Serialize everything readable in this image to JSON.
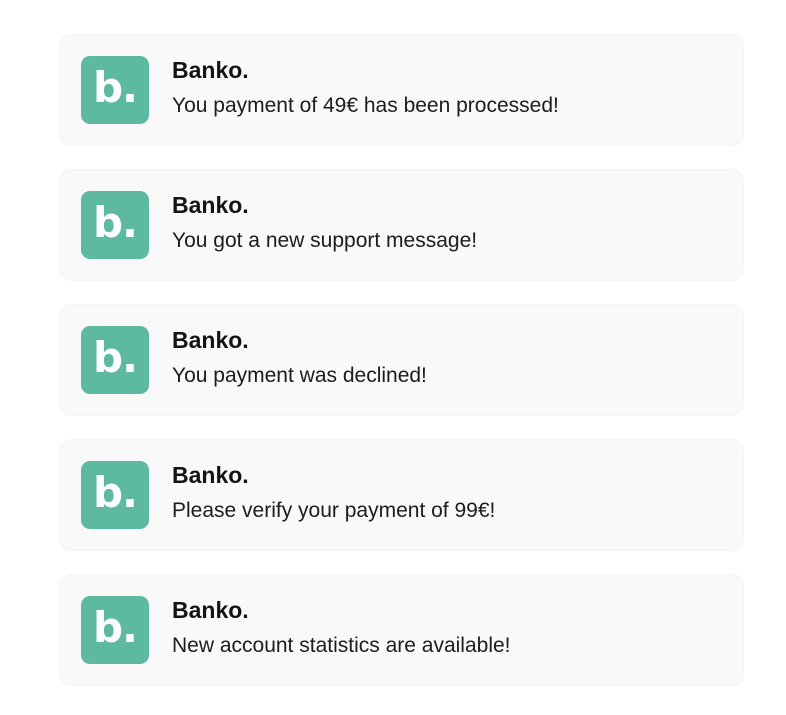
{
  "colors": {
    "brand": "#5db9a0",
    "card_background": "#f9f9f9",
    "text": "#141414"
  },
  "logo_icon": "banko-b-logo",
  "notifications": [
    {
      "logo_text": "b.",
      "app_name": "Banko.",
      "message": "You payment of 49€ has been processed!"
    },
    {
      "logo_text": "b.",
      "app_name": "Banko.",
      "message": "You got a new support message!"
    },
    {
      "logo_text": "b.",
      "app_name": "Banko.",
      "message": "You payment was declined!"
    },
    {
      "logo_text": "b.",
      "app_name": "Banko.",
      "message": "Please verify your payment of 99€!"
    },
    {
      "logo_text": "b.",
      "app_name": "Banko.",
      "message": "New account statistics are available!"
    }
  ]
}
